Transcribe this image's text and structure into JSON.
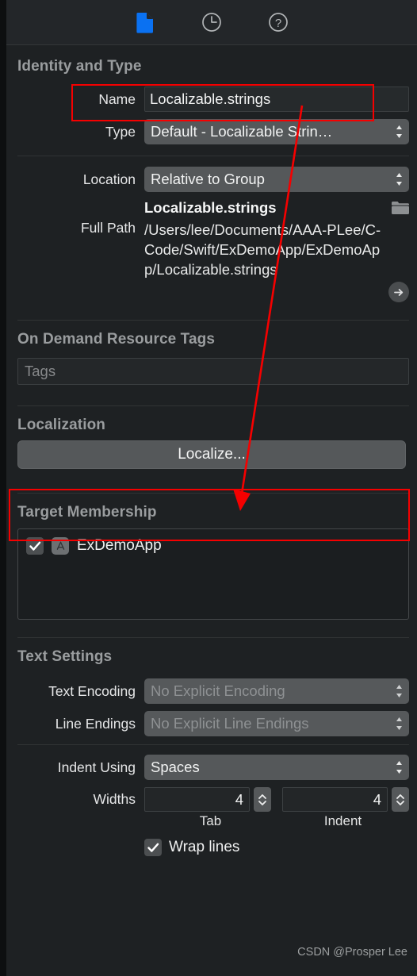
{
  "toolbar": {
    "icons": [
      {
        "name": "file-inspector-icon",
        "label": "File Inspector",
        "selected": true
      },
      {
        "name": "history-inspector-icon",
        "label": "History Inspector",
        "selected": false
      },
      {
        "name": "quick-help-icon",
        "label": "Quick Help Inspector",
        "selected": false
      }
    ],
    "accent_color": "#0a71f2"
  },
  "identity": {
    "section_title": "Identity and Type",
    "name_label": "Name",
    "name_value": "Localizable.strings",
    "type_label": "Type",
    "type_value": "Default - Localizable Strin…"
  },
  "location": {
    "location_label": "Location",
    "location_value": "Relative to Group",
    "file_name": "Localizable.strings",
    "full_path_label": "Full Path",
    "full_path_value": "/Users/lee/Documents/AAA-PLee/C-Code/Swift/ExDemoApp/ExDemoApp/Localizable.strings"
  },
  "on_demand": {
    "section_title": "On Demand Resource Tags",
    "tags_placeholder": "Tags",
    "tags_value": ""
  },
  "localization": {
    "section_title": "Localization",
    "button_label": "Localize..."
  },
  "target_membership": {
    "section_title": "Target Membership",
    "targets": [
      {
        "name": "ExDemoApp",
        "checked": true
      }
    ]
  },
  "text_settings": {
    "section_title": "Text Settings",
    "encoding_label": "Text Encoding",
    "encoding_value": "No Explicit Encoding",
    "line_endings_label": "Line Endings",
    "line_endings_value": "No Explicit Line Endings",
    "indent_label": "Indent Using",
    "indent_value": "Spaces",
    "widths_label": "Widths",
    "tab_width": "4",
    "indent_width": "4",
    "tab_sub_label": "Tab",
    "indent_sub_label": "Indent",
    "wrap_lines_label": "Wrap lines",
    "wrap_lines_checked": true
  },
  "watermark": "CSDN @Prosper Lee",
  "annotations": {
    "highlight_color": "#f50000",
    "boxes": [
      "name-field",
      "localize-button"
    ],
    "arrow": "from-name-field-to-localize-button"
  }
}
